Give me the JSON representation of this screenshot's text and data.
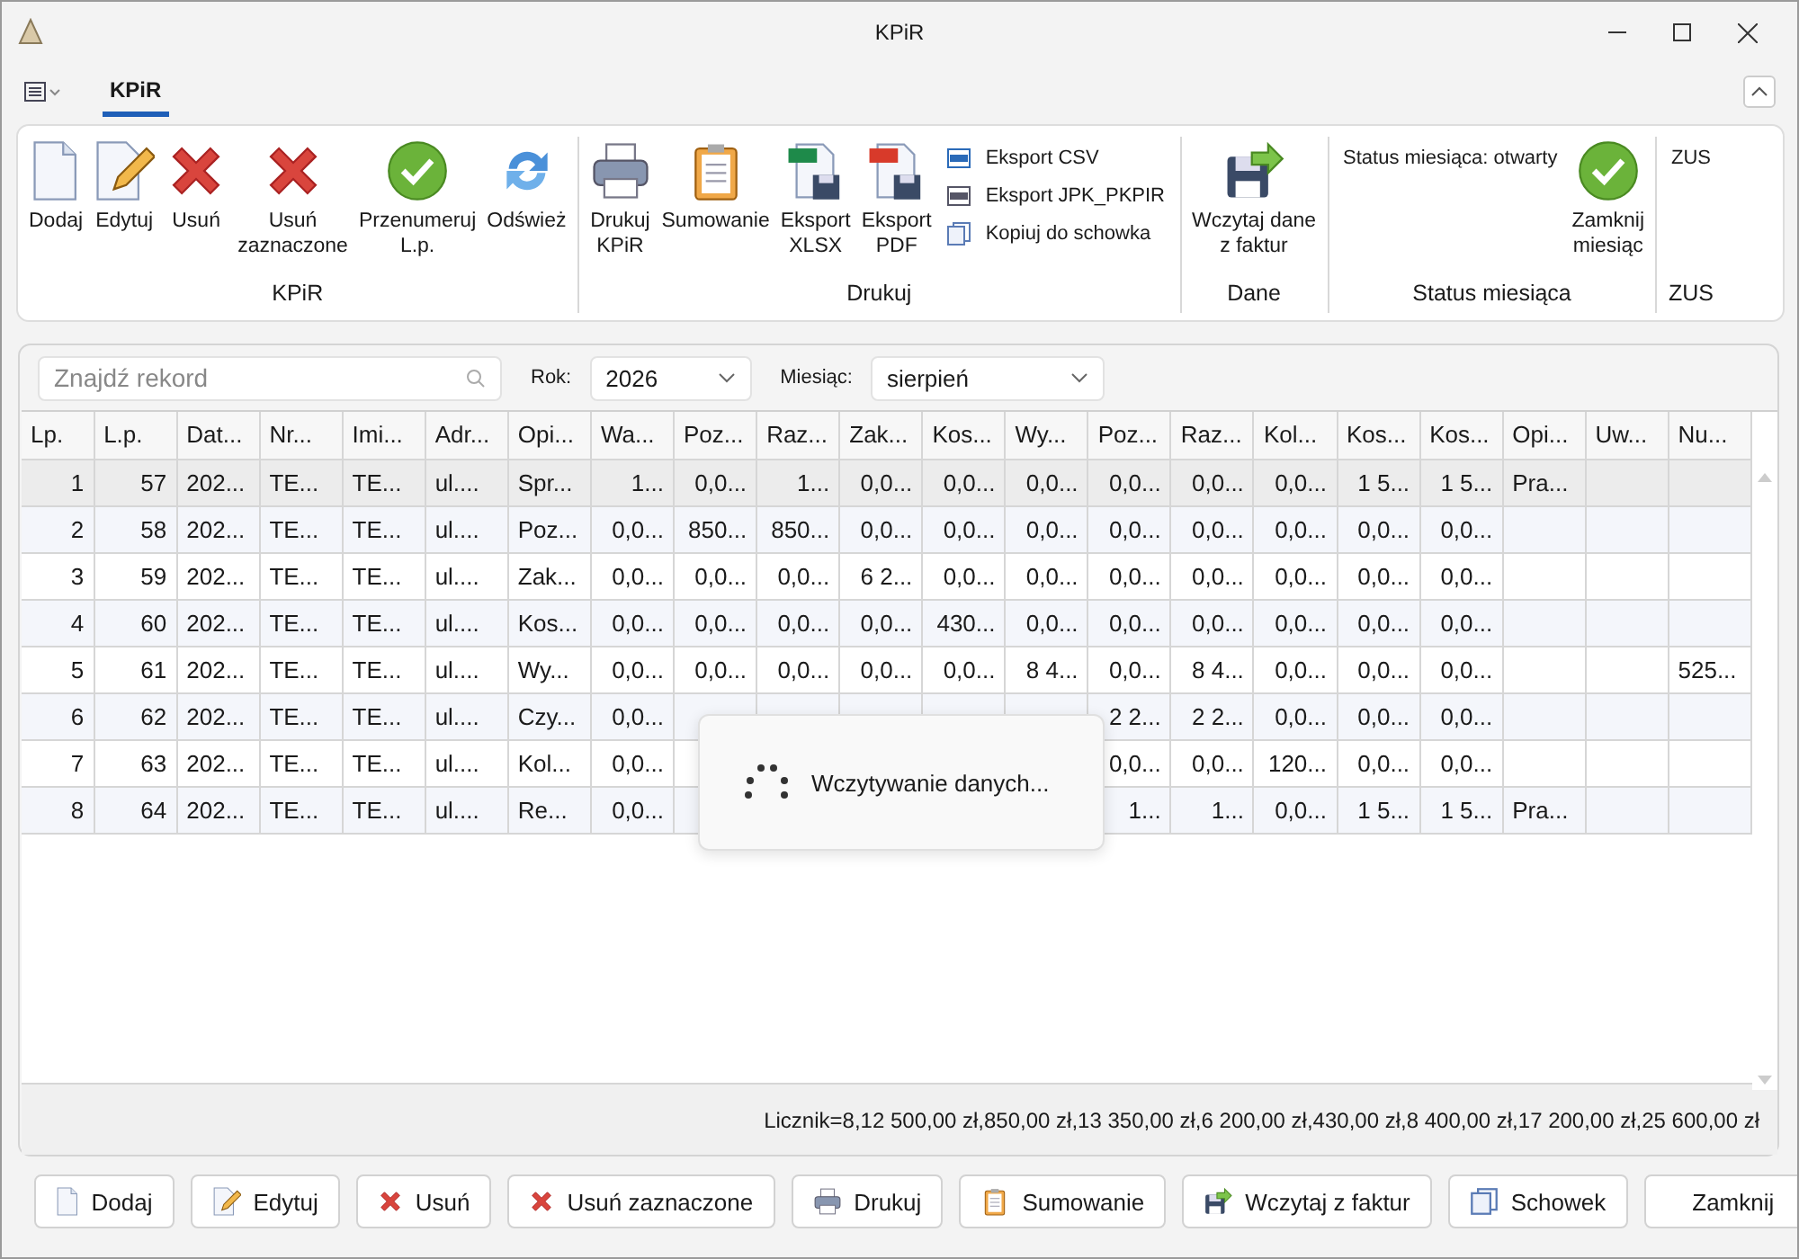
{
  "window": {
    "title": "KPiR"
  },
  "tabs": [
    {
      "label": "KPiR",
      "selected": true
    }
  ],
  "ribbon": [
    {
      "label": "KPiR",
      "items": [
        {
          "kind": "large",
          "label": "Dodaj"
        },
        {
          "kind": "large",
          "label": "Edytuj"
        },
        {
          "kind": "large",
          "label": "Usuń"
        },
        {
          "kind": "large",
          "label": "Usuń\nzaznaczone"
        },
        {
          "kind": "large",
          "label": "Przenumeruj\nL.p."
        },
        {
          "kind": "large",
          "label": "Odśwież"
        }
      ]
    },
    {
      "label": "Drukuj",
      "items": [
        {
          "kind": "large",
          "label": "Drukuj\nKPiR"
        },
        {
          "kind": "large",
          "label": "Sumowanie"
        },
        {
          "kind": "large",
          "label": "Eksport\nXLSX"
        },
        {
          "kind": "large",
          "label": "Eksport\nPDF"
        },
        {
          "kind": "small",
          "label": "Eksport CSV"
        },
        {
          "kind": "small",
          "label": "Eksport JPK_PKPIR"
        },
        {
          "kind": "small",
          "label": "Kopiuj do schowka"
        }
      ]
    },
    {
      "label": "Dane",
      "items": [
        {
          "kind": "large",
          "label": "Wczytaj dane\nz faktur"
        }
      ]
    },
    {
      "label": "Status miesiąca",
      "items": [
        {
          "kind": "text",
          "label": "Status miesiąca: otwarty"
        },
        {
          "kind": "large",
          "label": "Zamknij\nmiesiąc"
        }
      ]
    },
    {
      "label": "ZUS",
      "items": [
        {
          "kind": "text",
          "label": "ZUS"
        }
      ]
    }
  ],
  "filters": {
    "search": {
      "placeholder": "Znajdź rekord"
    },
    "year": {
      "label": "Rok:",
      "value": "2026"
    },
    "month": {
      "label": "Miesiąc:",
      "value": "sierpień"
    }
  },
  "table": {
    "columns": [
      "Lp.",
      "L.p.",
      "Dat...",
      "Nr...",
      "Imi...",
      "Adr...",
      "Opi...",
      "Wa...",
      "Poz...",
      "Raz...",
      "Zak...",
      "Kos...",
      "Wy...",
      "Poz...",
      "Raz...",
      "Kol...",
      "Kos...",
      "Kos...",
      "Opi...",
      "Uw...",
      "Nu..."
    ],
    "rows": [
      {
        "selected": true,
        "cells": [
          "1",
          "57",
          "202...",
          "TE...",
          "TE...",
          "ul....",
          "Spr...",
          "1...",
          "0,0...",
          "1...",
          "0,0...",
          "0,0...",
          "0,0...",
          "0,0...",
          "0,0...",
          "0,0...",
          "1 5...",
          "1 5...",
          "Pra...",
          null,
          null
        ]
      },
      {
        "selected": false,
        "cells": [
          "2",
          "58",
          "202...",
          "TE...",
          "TE...",
          "ul....",
          "Poz...",
          "0,0...",
          "850...",
          "850...",
          "0,0...",
          "0,0...",
          "0,0...",
          "0,0...",
          "0,0...",
          "0,0...",
          "0,0...",
          "0,0...",
          null,
          null,
          null
        ]
      },
      {
        "selected": false,
        "cells": [
          "3",
          "59",
          "202...",
          "TE...",
          "TE...",
          "ul....",
          "Zak...",
          "0,0...",
          "0,0...",
          "0,0...",
          "6 2...",
          "0,0...",
          "0,0...",
          "0,0...",
          "0,0...",
          "0,0...",
          "0,0...",
          "0,0...",
          null,
          null,
          null
        ]
      },
      {
        "selected": false,
        "cells": [
          "4",
          "60",
          "202...",
          "TE...",
          "TE...",
          "ul....",
          "Kos...",
          "0,0...",
          "0,0...",
          "0,0...",
          "0,0...",
          "430...",
          "0,0...",
          "0,0...",
          "0,0...",
          "0,0...",
          "0,0...",
          "0,0...",
          null,
          null,
          null
        ]
      },
      {
        "selected": false,
        "cells": [
          "5",
          "61",
          "202...",
          "TE...",
          "TE...",
          "ul....",
          "Wy...",
          "0,0...",
          "0,0...",
          "0,0...",
          "0,0...",
          "0,0...",
          "8 4...",
          "0,0...",
          "8 4...",
          "0,0...",
          "0,0...",
          "0,0...",
          null,
          null,
          "525..."
        ]
      },
      {
        "selected": false,
        "cells": [
          "6",
          "62",
          "202...",
          "TE...",
          "TE...",
          "ul....",
          "Czy...",
          "0,0...",
          null,
          null,
          null,
          null,
          null,
          "2 2...",
          "2 2...",
          "0,0...",
          "0,0...",
          "0,0...",
          null,
          null,
          null
        ]
      },
      {
        "selected": false,
        "cells": [
          "7",
          "63",
          "202...",
          "TE...",
          "TE...",
          "ul....",
          "Kol...",
          "0,0...",
          null,
          null,
          null,
          null,
          null,
          "0,0...",
          "0,0...",
          "120...",
          "0,0...",
          "0,0...",
          null,
          null,
          null
        ]
      },
      {
        "selected": false,
        "cells": [
          "8",
          "64",
          "202...",
          "TE...",
          "TE...",
          "ul....",
          "Re...",
          "0,0...",
          null,
          null,
          null,
          null,
          null,
          "1...",
          "1...",
          "0,0...",
          "1 5...",
          "1 5...",
          "Pra...",
          null,
          null
        ]
      }
    ],
    "footer": "Licznik=8,12 500,00 zł,850,00 zł,13 350,00 zł,6 200,00 zł,430,00 zł,8 400,00 zł,17 200,00 zł,25 600,00 zł"
  },
  "loading": {
    "text": "Wczytywanie danych..."
  },
  "buttons": [
    "Dodaj",
    "Edytuj",
    "Usuń",
    "Usuń zaznaczone",
    "Drukuj",
    "Sumowanie",
    "Wczytaj z faktur",
    "Schowek",
    "Zamknij"
  ]
}
